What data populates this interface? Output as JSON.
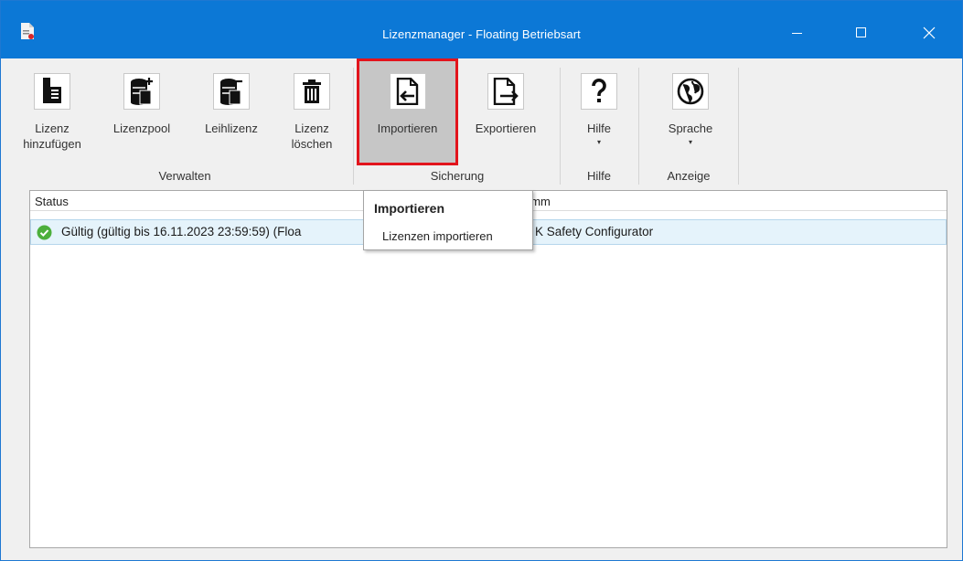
{
  "window": {
    "title": "Lizenzmanager - Floating Betriebsart",
    "controls": {
      "minimize": "minimize",
      "maximize": "maximize",
      "close": "close"
    },
    "accent": "#0c78d6"
  },
  "ribbon": {
    "verwalten": {
      "label": "Verwalten",
      "lizenz_hinzufuegen": {
        "line1": "Lizenz",
        "line2": "hinzufügen"
      },
      "lizenzpool": "Lizenzpool",
      "leihlizenz": "Leihlizenz",
      "lizenz_loeschen": {
        "line1": "Lizenz",
        "line2": "löschen"
      }
    },
    "sicherung": {
      "label": "Sicherung",
      "importieren": "Importieren",
      "exportieren": "Exportieren"
    },
    "hilfe": {
      "label": "Hilfe",
      "hilfe_button": "Hilfe",
      "dropdown": "▾"
    },
    "anzeige": {
      "label": "Anzeige",
      "sprache": "Sprache",
      "dropdown": "▾"
    }
  },
  "list": {
    "columns": [
      "Status",
      "amm"
    ],
    "rows": [
      {
        "status_icon": "check-circle-icon",
        "status": "Gültig (gültig bis 16.11.2023 23:59:59) (Floa",
        "program": "K Safety Configurator"
      }
    ]
  },
  "tooltip": {
    "title": "Importieren",
    "text": "Lizenzen importieren"
  },
  "colors": {
    "highlight_border": "#e2141c",
    "status_ok": "#4caf3c",
    "row_selected": "#e5f3fb"
  }
}
